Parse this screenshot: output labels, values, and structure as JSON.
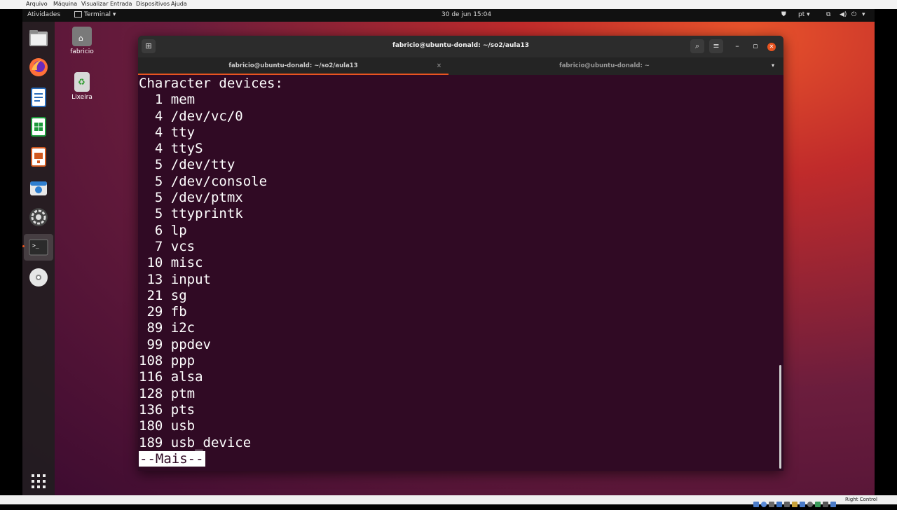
{
  "vbox_menu": [
    "Arquivo",
    "Máquina",
    "Visualizar",
    "Entrada",
    "Dispositivos",
    "Ajuda"
  ],
  "topbar": {
    "activities": "Atividades",
    "app_menu": "Terminal ▾",
    "clock": "30 de jun  15:04",
    "lang": "pt ▾"
  },
  "desktop": {
    "home_label": "fabricio",
    "trash_label": "Lixeira"
  },
  "window": {
    "title": "fabricio@ubuntu-donald: ~/so2/aula13",
    "tabs": [
      {
        "label": "fabricio@ubuntu-donald: ~/so2/aula13",
        "active": true
      },
      {
        "label": "fabricio@ubuntu-donald: ~",
        "active": false
      }
    ]
  },
  "terminal": {
    "lines": [
      "Character devices:",
      "  1 mem",
      "  4 /dev/vc/0",
      "  4 tty",
      "  4 ttyS",
      "  5 /dev/tty",
      "  5 /dev/console",
      "  5 /dev/ptmx",
      "  5 ttyprintk",
      "  6 lp",
      "  7 vcs",
      " 10 misc",
      " 13 input",
      " 21 sg",
      " 29 fb",
      " 89 i2c",
      " 99 ppdev",
      "108 ppp",
      "116 alsa",
      "128 ptm",
      "136 pts",
      "180 usb",
      "189 usb_device"
    ],
    "pager_prompt": "--Mais--"
  },
  "statusbar": {
    "host_key": "Right Control"
  },
  "colors": {
    "terminal_bg": "#300a24",
    "accent": "#e95420"
  }
}
